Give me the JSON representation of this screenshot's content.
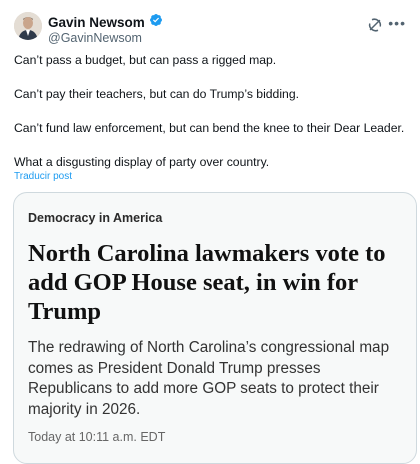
{
  "author": {
    "name": "Gavin Newsom",
    "handle": "@GavinNewsom",
    "verified": true
  },
  "tweet": {
    "lines": [
      "Can’t pass a budget, but can pass a rigged map.",
      "Can’t pay their teachers, but can do Trump’s bidding.",
      "Can’t fund law enforcement, but can bend the knee to their Dear Leader.",
      "What a disgusting display of party over country."
    ],
    "translate_label": "Traducir post"
  },
  "card": {
    "kicker": "Democracy in America",
    "headline": "North Carolina lawmakers vote to add GOP House seat, in win for Trump",
    "summary": "The redrawing of North Carolina’s congressional map comes as President Donald Trump presses Republicans to add more GOP seats to protect their majority in 2026.",
    "timestamp": "Today at 10:11 a.m. EDT"
  },
  "colors": {
    "verified_badge": "#1d9bf0",
    "link": "#1d9bf0"
  },
  "icons": {
    "grok": "grok-icon",
    "more": "more-options-icon",
    "verified": "verified-badge-icon"
  }
}
